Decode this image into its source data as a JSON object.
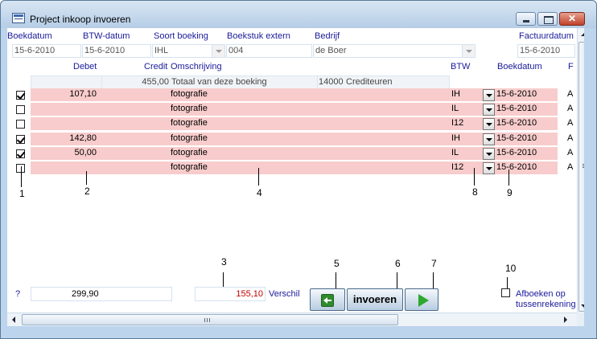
{
  "window": {
    "title": "Project inkoop invoeren"
  },
  "header": {
    "boekdatum_label": "Boekdatum",
    "btwdatum_label": "BTW-datum",
    "soort_label": "Soort boeking",
    "boekstuk_label": "Boekstuk extern",
    "bedrijf_label": "Bedrijf",
    "factuurdatum_label": "Factuurdatum",
    "boekdatum_value": "15-6-2010",
    "btwdatum_value": "15-6-2010",
    "soort_value": "IHL",
    "boekstuk_value": "004",
    "bedrijf_value": "de Boer",
    "factuurdatum_value": "15-6-2010"
  },
  "columns": {
    "debet": "Debet",
    "credit": "Credit",
    "omschrijving": "Omschrijving",
    "btw": "BTW",
    "boekdatum": "Boekdatum",
    "f": "F"
  },
  "summary": {
    "credit": "455,00",
    "omschrijving": "Totaal van deze boeking",
    "code": "14000",
    "rekening": "Crediteuren"
  },
  "rows": [
    {
      "checked": true,
      "debet": "107,10",
      "omschrijving": "fotografie",
      "btw": "IH",
      "boekdatum": "15-6-2010",
      "f": "A"
    },
    {
      "checked": false,
      "debet": "",
      "omschrijving": "fotografie",
      "btw": "IL",
      "boekdatum": "15-6-2010",
      "f": "A"
    },
    {
      "checked": false,
      "debet": "",
      "omschrijving": "fotografie",
      "btw": "I12",
      "boekdatum": "15-6-2010",
      "f": "A"
    },
    {
      "checked": true,
      "debet": "142,80",
      "omschrijving": "fotografie",
      "btw": "IH",
      "boekdatum": "15-6-2010",
      "f": "A"
    },
    {
      "checked": true,
      "debet": "50,00",
      "omschrijving": "fotografie",
      "btw": "IL",
      "boekdatum": "15-6-2010",
      "f": "A"
    },
    {
      "checked": false,
      "debet": "",
      "omschrijving": "fotografie",
      "btw": "I12",
      "boekdatum": "15-6-2010",
      "f": "A"
    }
  ],
  "callouts": [
    "1",
    "2",
    "3",
    "4",
    "5",
    "6",
    "7",
    "8",
    "9",
    "10"
  ],
  "footer": {
    "question": "?",
    "total": "299,90",
    "verschil_value": "155,10",
    "verschil_label": "Verschil",
    "invoeren_label": "invoeren",
    "afboeken_line1": "Afboeken op",
    "afboeken_line2": "tussenrekening",
    "afboeken_checked": false
  },
  "colors": {
    "row_background": "#f8cccc",
    "header_text": "#1a1a9a",
    "verschil_value": "#c00000"
  },
  "icons": {
    "back_button": "back-arrow-icon",
    "next_button": "play-icon",
    "window_icon": "form-icon"
  }
}
